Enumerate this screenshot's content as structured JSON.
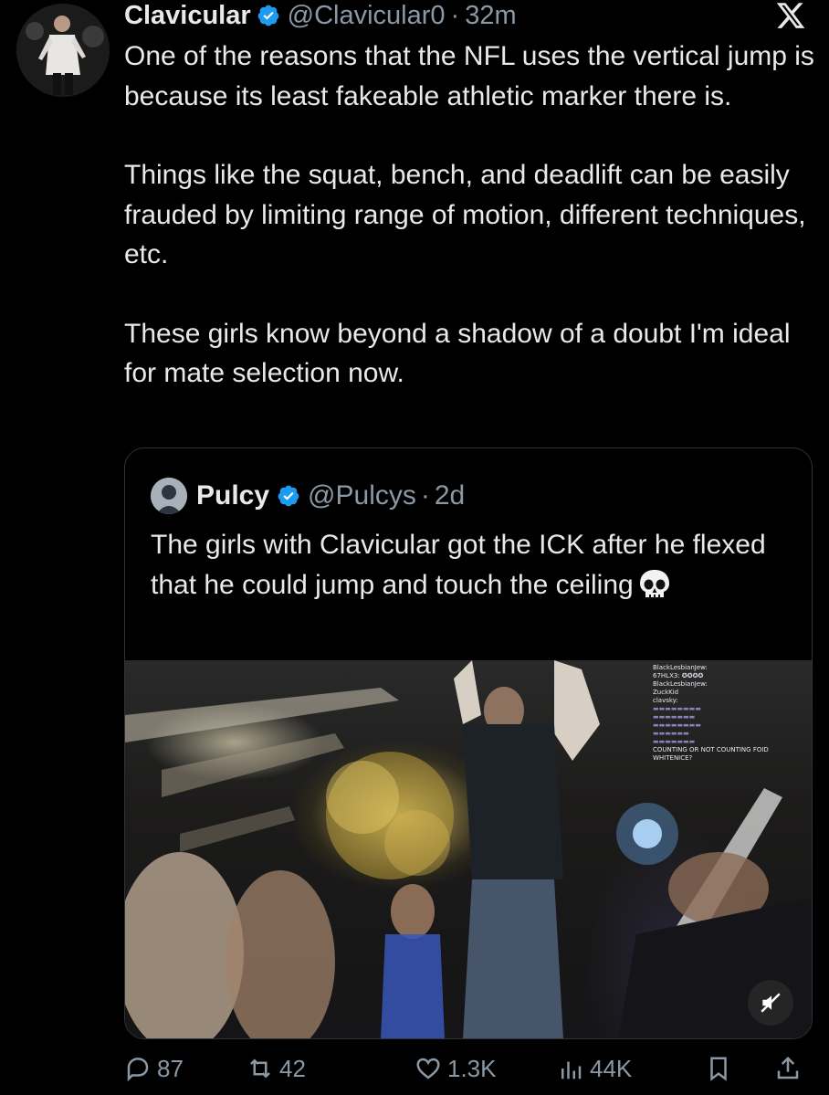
{
  "tweet": {
    "author_name": "Clavicular",
    "handle": "@Clavicular0",
    "separator": "·",
    "time": "32m",
    "paragraphs": [
      "One of the reasons that the NFL uses the vertical jump is because its least fakeable athletic marker there is.",
      "Things like the squat, bench, and deadlift can be easily frauded by limiting range of motion, different techniques, etc.",
      "These girls know beyond a shadow of a doubt I'm ideal for mate selection now."
    ],
    "icons": {
      "verified": "verified-badge-icon",
      "logo": "x-logo-icon"
    },
    "accent_color": "#1d9bf0"
  },
  "quote": {
    "author_name": "Pulcy",
    "handle": "@Pulcys",
    "separator": "·",
    "time": "2d",
    "text": "The girls with Clavicular got the ICK after he flexed that he could jump and touch the ceiling",
    "emoji": "skull-emoji"
  },
  "media": {
    "chat_lines": [
      "BlackLesbianJew:",
      "67HLX3: ✪✪✪✪",
      "BlackLesbianJew:",
      "ZuckKid",
      "clavsky:",
      "",
      "",
      "",
      "",
      "",
      "COUNTING OR NOT COUNTING FOID",
      "WHITENICE?"
    ],
    "mute_icon": "volume-muted-icon"
  },
  "actions": {
    "reply_count": "87",
    "repost_count": "42",
    "like_count": "1.3K",
    "view_count": "44K"
  }
}
